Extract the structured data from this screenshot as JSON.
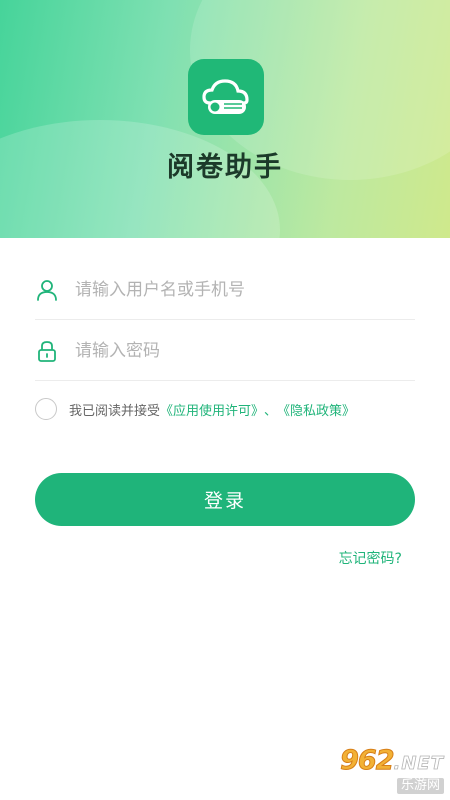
{
  "header": {
    "app_name": "阅卷助手",
    "brand_color": "#1fb47a"
  },
  "login_form": {
    "username_placeholder": "请输入用户名或手机号",
    "password_placeholder": "请输入密码",
    "agreement_prefix": "我已阅读并接受",
    "user_license_link": "《应用使用许可》",
    "separator": "、",
    "privacy_policy_link": "《隐私政策》",
    "login_button": "登录",
    "forgot_password": "忘记密码?"
  },
  "icons": {
    "logo": "cloud-scroll-icon",
    "username": "user-icon",
    "password": "lock-icon"
  },
  "watermark": {
    "brand": "962",
    "domain": ".NET",
    "caption": "乐游网"
  }
}
